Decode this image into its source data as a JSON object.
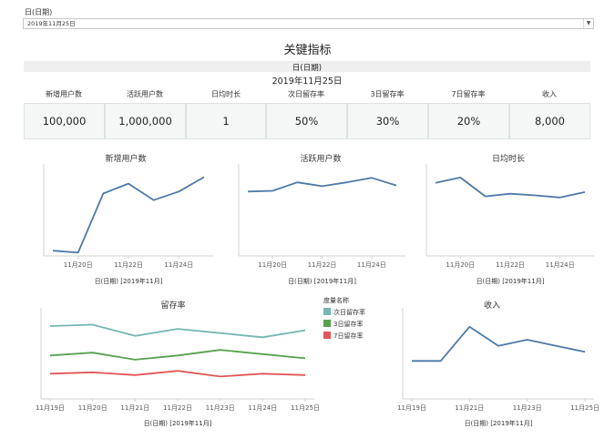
{
  "filter": {
    "label": "日(日期)",
    "value": "2019年11月25日"
  },
  "dashboard_title": "关键指标",
  "kpi": {
    "header": "日(日期)",
    "date": "2019年11月25日",
    "columns": [
      {
        "label": "新增用户数",
        "value": "100,000"
      },
      {
        "label": "活跃用户数",
        "value": "1,000,000"
      },
      {
        "label": "日均时长",
        "value": "1"
      },
      {
        "label": "次日留存率",
        "value": "50%"
      },
      {
        "label": "3日留存率",
        "value": "30%"
      },
      {
        "label": "7日留存率",
        "value": "20%"
      },
      {
        "label": "收入",
        "value": "8,000"
      }
    ]
  },
  "colors": {
    "line": "#4e79a7",
    "next_day": "#76b7b2",
    "day3": "#59a14f",
    "day7": "#e15759",
    "axis": "#d0d0d0"
  },
  "chart_data": [
    {
      "type": "line",
      "title": "新增用户数",
      "xlabel": "日(日期) [2019年11月]",
      "ylabel": "",
      "x": [
        "11月19日",
        "11月20日",
        "11月21日",
        "11月22日",
        "11月23日",
        "11月24日",
        "11月25日"
      ],
      "tick_labels": [
        "11月20日",
        "11月22日",
        "11月24日"
      ],
      "series": [
        {
          "values": [
            8000,
            5000,
            95000,
            110000,
            85000,
            98000,
            120000
          ]
        }
      ],
      "ylim": [
        0,
        140000
      ],
      "grid": false
    },
    {
      "type": "line",
      "title": "活跃用户数",
      "xlabel": "日(日期) [2019年11月]",
      "ylabel": "",
      "x": [
        "11月19日",
        "11月20日",
        "11月21日",
        "11月22日",
        "11月23日",
        "11月24日",
        "11月25日"
      ],
      "tick_labels": [
        "11月20日",
        "11月22日",
        "11月24日"
      ],
      "series": [
        {
          "values": [
            840000,
            850000,
            960000,
            910000,
            960000,
            1020000,
            920000
          ]
        }
      ],
      "ylim": [
        0,
        1200000
      ],
      "grid": false
    },
    {
      "type": "line",
      "title": "日均时长",
      "xlabel": "日(日期) [2019年11月]",
      "ylabel": "",
      "x": [
        "11月19日",
        "11月20日",
        "11月21日",
        "11月22日",
        "11月23日",
        "11月24日",
        "11月25日"
      ],
      "tick_labels": [
        "11月20日",
        "11月22日",
        "11月24日"
      ],
      "series": [
        {
          "values": [
            1.35,
            1.45,
            1.1,
            1.15,
            1.12,
            1.08,
            1.18
          ]
        }
      ],
      "ylim": [
        0,
        1.7
      ],
      "grid": false
    },
    {
      "type": "line",
      "title": "留存率",
      "xlabel": "日(日期) [2019年11月]",
      "ylabel": "",
      "x": [
        "11月19日",
        "11月20日",
        "11月21日",
        "11月22日",
        "11月23日",
        "11月24日",
        "11月25日"
      ],
      "tick_labels": [
        "11月19日",
        "11月20日",
        "11月21日",
        "11月22日",
        "11月23日",
        "11月24日",
        "11月25日"
      ],
      "legend_title": "度量名称",
      "series": [
        {
          "name": "次日留存率",
          "values": [
            0.52,
            0.53,
            0.45,
            0.5,
            0.47,
            0.44,
            0.49
          ]
        },
        {
          "name": "3日留存率",
          "values": [
            0.31,
            0.33,
            0.28,
            0.31,
            0.35,
            0.32,
            0.29
          ]
        },
        {
          "name": "7日留存率",
          "values": [
            0.18,
            0.19,
            0.17,
            0.2,
            0.16,
            0.18,
            0.17
          ]
        }
      ],
      "ylim": [
        0,
        0.65
      ],
      "grid": false,
      "legend_position": "right"
    },
    {
      "type": "line",
      "title": "收入",
      "xlabel": "日(日期) [2019年11月]",
      "ylabel": "",
      "x": [
        "11月19日",
        "11月20日",
        "11月21日",
        "11月22日",
        "11月23日",
        "11月24日",
        "11月25日"
      ],
      "tick_labels": [
        "11月19日",
        "11月21日",
        "11月23日",
        "11月25日"
      ],
      "series": [
        {
          "values": [
            5000,
            5000,
            9500,
            7000,
            7800,
            7000,
            6200
          ]
        }
      ],
      "ylim": [
        0,
        12000
      ],
      "grid": false
    }
  ]
}
